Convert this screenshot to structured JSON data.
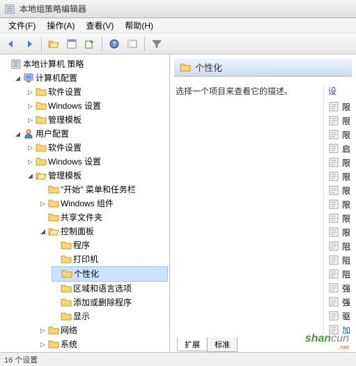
{
  "window": {
    "title": "本地组策略编辑器"
  },
  "menu": {
    "file": "文件(F)",
    "action": "操作(A)",
    "view": "查看(V)",
    "help": "帮助(H)"
  },
  "toolbar": {
    "back_icon": "back",
    "forward_icon": "forward",
    "up_icon": "up",
    "props_icon": "properties",
    "export_icon": "export",
    "help_icon": "help",
    "show_icon": "show",
    "filter_icon": "filter"
  },
  "tree": {
    "root": "本地计算机 策略",
    "computer_config": "计算机配置",
    "cc_software": "软件设置",
    "cc_windows": "Windows 设置",
    "cc_admin": "管理模板",
    "user_config": "用户配置",
    "uc_software": "软件设置",
    "uc_windows": "Windows 设置",
    "uc_admin": "管理模板",
    "start_taskbar": "\"开始\" 菜单和任务栏",
    "win_components": "Windows 组件",
    "shared_folders": "共享文件夹",
    "control_panel": "控制面板",
    "programs": "程序",
    "printers": "打印机",
    "personalization": "个性化",
    "region_lang": "区域和语言选项",
    "add_remove": "添加或删除程序",
    "display": "显示",
    "network": "网络",
    "system": "系统"
  },
  "details": {
    "header_title": "个性化",
    "description": "选择一个项目来查看它的描述。",
    "column_header": "设",
    "items": [
      "限",
      "限",
      "限",
      "启",
      "限",
      "限",
      "限",
      "限",
      "限",
      "限",
      "阻",
      "阻",
      "阻",
      "强",
      "强",
      "驱",
      "加"
    ]
  },
  "tabs": {
    "extended": "扩展",
    "standard": "标准"
  },
  "status": {
    "text": "16 个设置"
  },
  "icon_names": {
    "policy_root": "policy-root-icon",
    "computer": "computer-icon",
    "user": "user-icon",
    "folder_closed": "folder-closed-icon",
    "folder_open": "folder-open-icon",
    "setting_item": "setting-item-icon"
  },
  "colors": {
    "folder_fill": "#f7d774",
    "folder_stroke": "#b8860b",
    "selection": "#cbe3ff",
    "header_grad_a": "#eef3fa",
    "header_grad_b": "#cdddf0"
  },
  "watermark": {
    "text1": "shan",
    "text2": "cun",
    "sub": ".net"
  }
}
